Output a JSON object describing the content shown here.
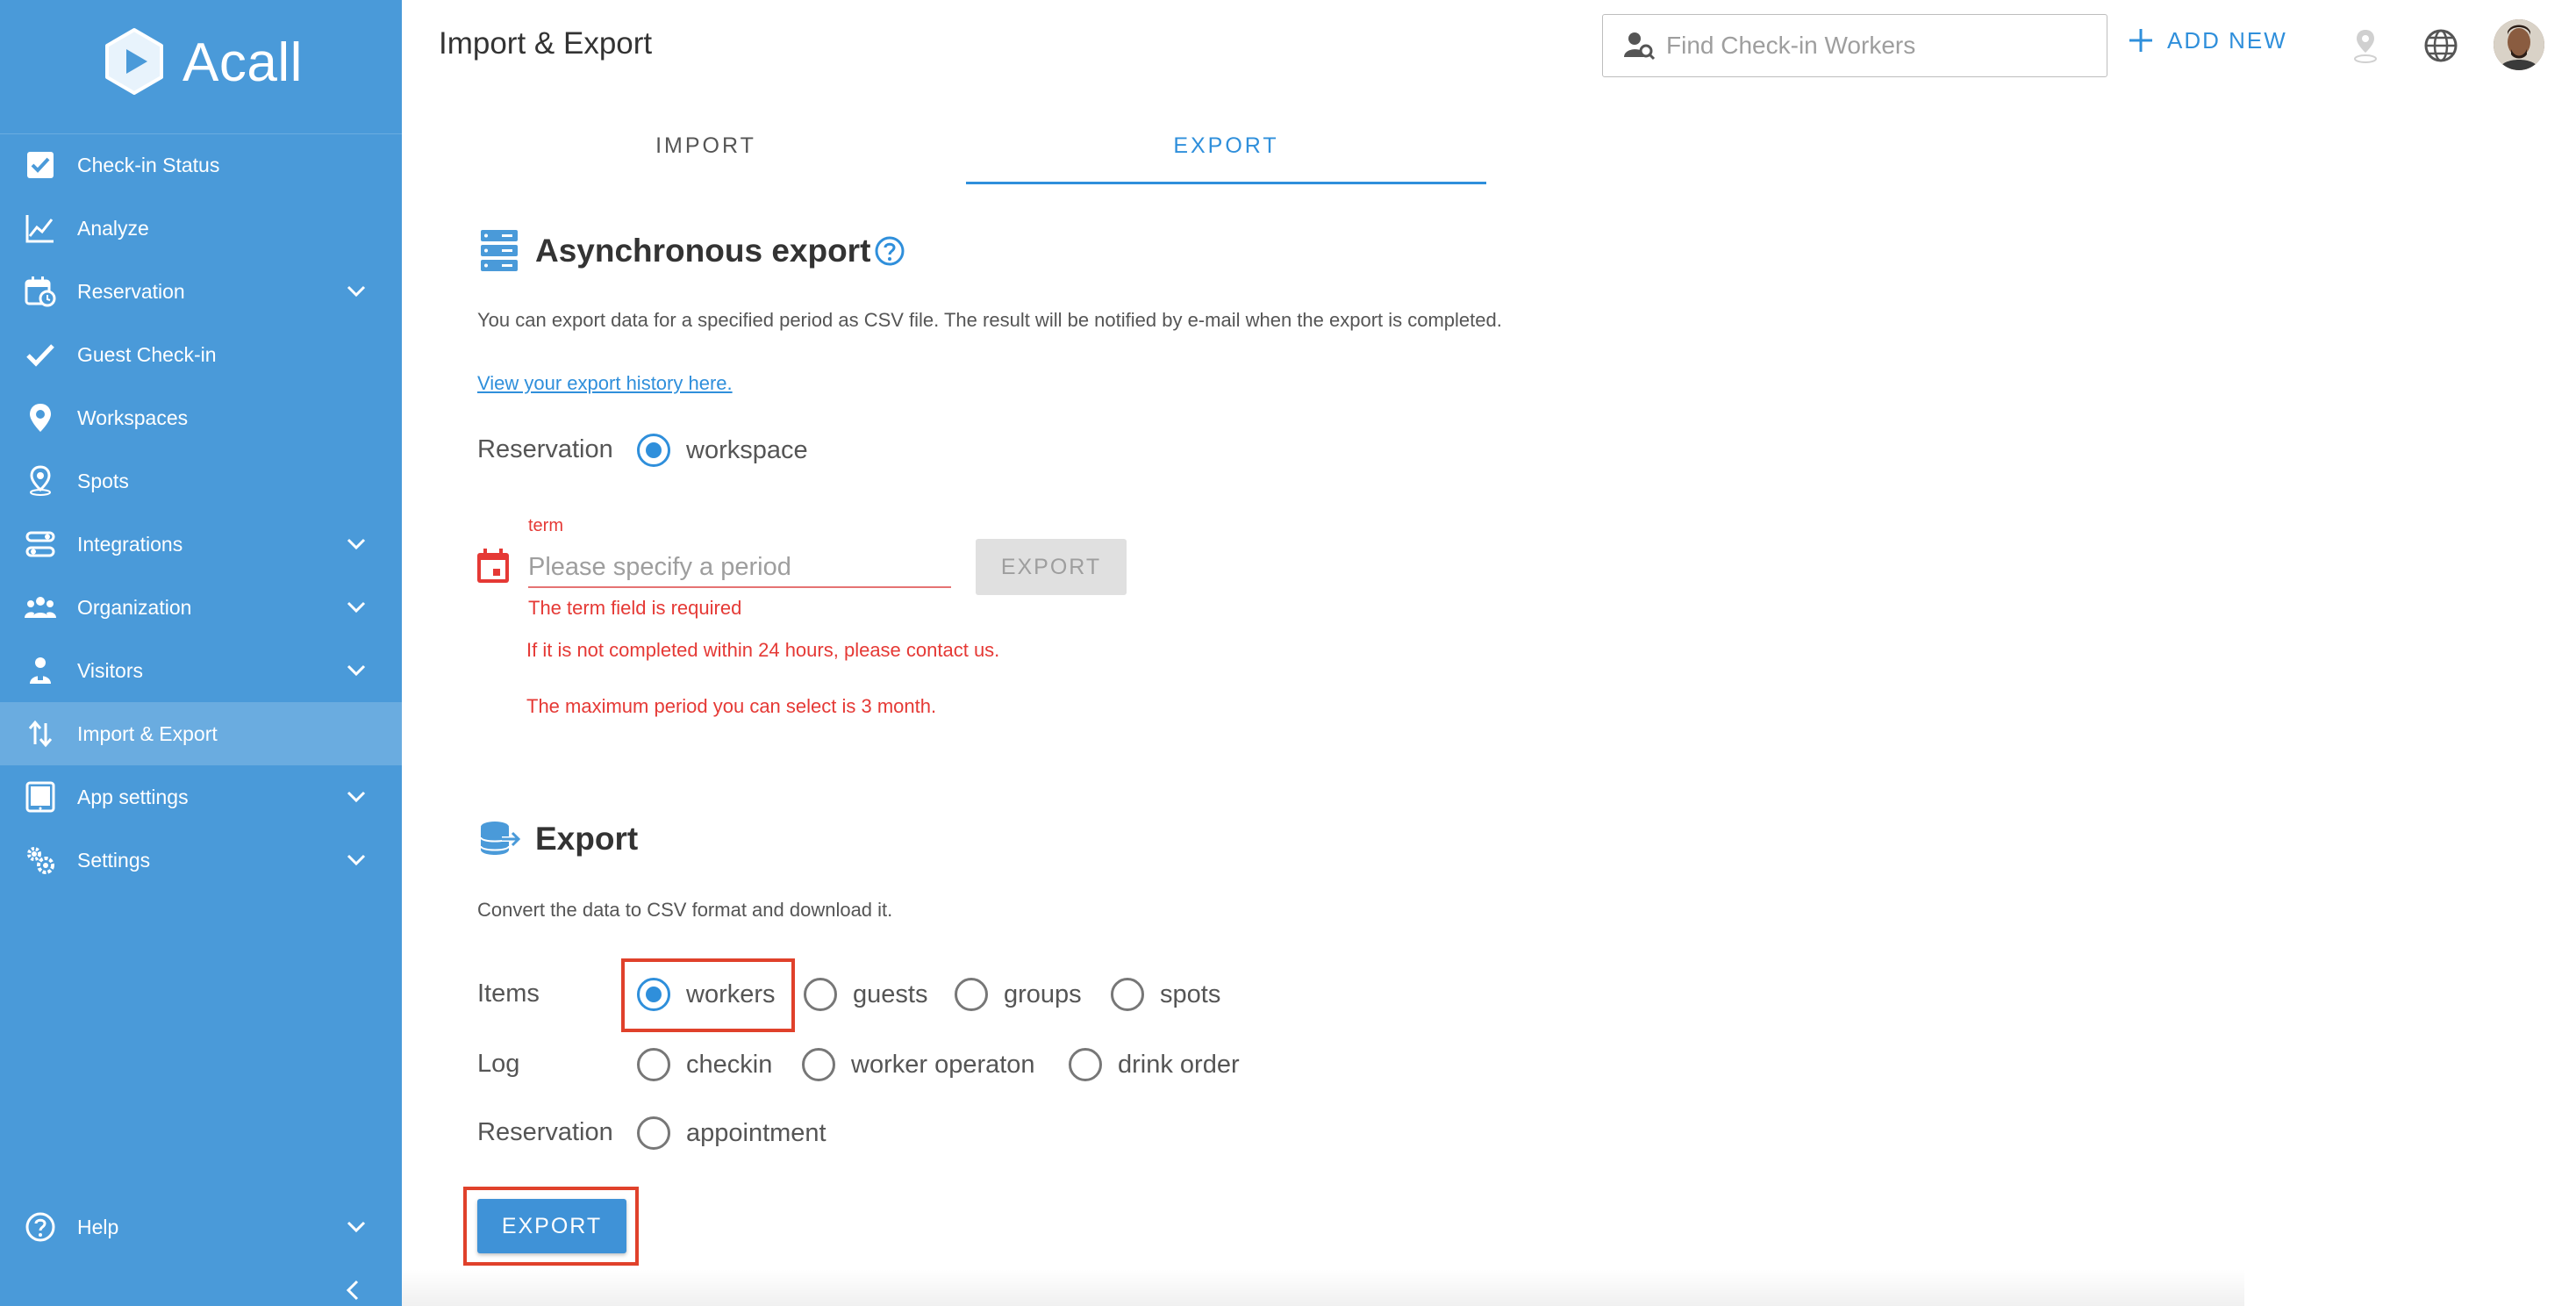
{
  "sidebar": {
    "brand": "Acall",
    "items": [
      {
        "label": "Check-in Status",
        "icon": "checkbox-icon",
        "chevron": false
      },
      {
        "label": "Analyze",
        "icon": "line-chart-icon",
        "chevron": false
      },
      {
        "label": "Reservation",
        "icon": "calendar-clock-icon",
        "chevron": true
      },
      {
        "label": "Guest Check-in",
        "icon": "checkmark-icon",
        "chevron": false
      },
      {
        "label": "Workspaces",
        "icon": "location-pin-icon",
        "chevron": false
      },
      {
        "label": "Spots",
        "icon": "spot-pin-icon",
        "chevron": false
      },
      {
        "label": "Integrations",
        "icon": "integrations-icon",
        "chevron": true
      },
      {
        "label": "Organization",
        "icon": "people-icon",
        "chevron": true
      },
      {
        "label": "Visitors",
        "icon": "visitor-icon",
        "chevron": true
      },
      {
        "label": "Import & Export",
        "icon": "import-export-icon",
        "chevron": false,
        "active": true
      },
      {
        "label": "App settings",
        "icon": "tablet-icon",
        "chevron": true
      },
      {
        "label": "Settings",
        "icon": "gears-icon",
        "chevron": true
      }
    ],
    "help_label": "Help"
  },
  "header": {
    "title": "Import & Export",
    "search_placeholder": "Find Check-in Workers",
    "add_new_label": "ADD NEW"
  },
  "tabs": {
    "import_label": "IMPORT",
    "export_label": "EXPORT",
    "active": "EXPORT"
  },
  "async_export": {
    "title": "Asynchronous export",
    "description": "You can export data for a specified period as CSV file. The result will be notified by e-mail when the export is completed.",
    "history_link": "View your export history here.",
    "reservation_label": "Reservation",
    "reservation_option": "workspace",
    "term_label": "term",
    "term_placeholder": "Please specify a period",
    "export_button": "EXPORT",
    "error_required": "The term field is required",
    "note_24h": "If it is not completed within 24 hours, please contact us.",
    "note_max": "The maximum period you can select is 3 month."
  },
  "export": {
    "title": "Export",
    "description": "Convert the data to CSV format and download it.",
    "items_label": "Items",
    "items_options": [
      "workers",
      "guests",
      "groups",
      "spots"
    ],
    "items_selected": "workers",
    "log_label": "Log",
    "log_options": [
      "checkin",
      "worker operaton",
      "drink order"
    ],
    "reservation_label": "Reservation",
    "reservation_options": [
      "appointment"
    ],
    "export_button": "EXPORT"
  },
  "colors": {
    "sidebar_bg": "#4a9ad9",
    "accent": "#2f8fdb",
    "error": "#e53935",
    "highlight_box": "#e0412b"
  }
}
